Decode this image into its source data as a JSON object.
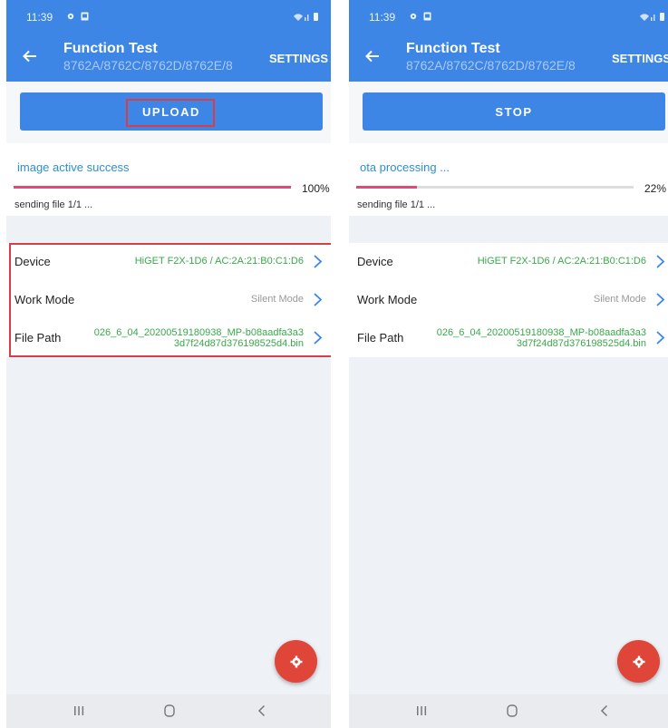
{
  "screens": [
    {
      "status_time": "11:39",
      "title": "Function Test",
      "subtitle": "8762A/8762C/8762D/8762E/8...",
      "settings_label": "SETTINGS",
      "action_label": "UPLOAD",
      "progress_status": "image active success",
      "progress": 100,
      "progress_label": "100%",
      "sending_text": "sending file 1/1 ...",
      "rows": [
        {
          "label": "Device",
          "value_line1": "HiGET F2X-1D6 / AC:2A:21:B0:C1:D6",
          "value_line2": ""
        },
        {
          "label": "Work Mode",
          "value_line1": "Silent Mode",
          "value_line2": ""
        },
        {
          "label": "File Path",
          "value_line1": "026_6_04_20200519180938_MP-b08aadfa3a3",
          "value_line2": "3d7f24d87d376198525d4.bin"
        }
      ]
    },
    {
      "status_time": "11:39",
      "title": "Function Test",
      "subtitle": "8762A/8762C/8762D/8762E/8...",
      "settings_label": "SETTINGS",
      "action_label": "STOP",
      "progress_status": "ota processing ...",
      "progress": 22,
      "progress_label": "22%",
      "sending_text": "sending file 1/1 ...",
      "rows": [
        {
          "label": "Device",
          "value_line1": "HiGET F2X-1D6 / AC:2A:21:B0:C1:D6",
          "value_line2": ""
        },
        {
          "label": "Work Mode",
          "value_line1": "Silent Mode",
          "value_line2": ""
        },
        {
          "label": "File Path",
          "value_line1": "026_6_04_20200519180938_MP-b08aadfa3a3",
          "value_line2": "3d7f24d87d376198525d4.bin"
        }
      ]
    }
  ],
  "colors": {
    "appbar": "#3d86e6",
    "progress_fill": "#e04a77",
    "highlight": "#d93d4a",
    "value_green": "#3aa84a",
    "fab": "#e0453a"
  }
}
